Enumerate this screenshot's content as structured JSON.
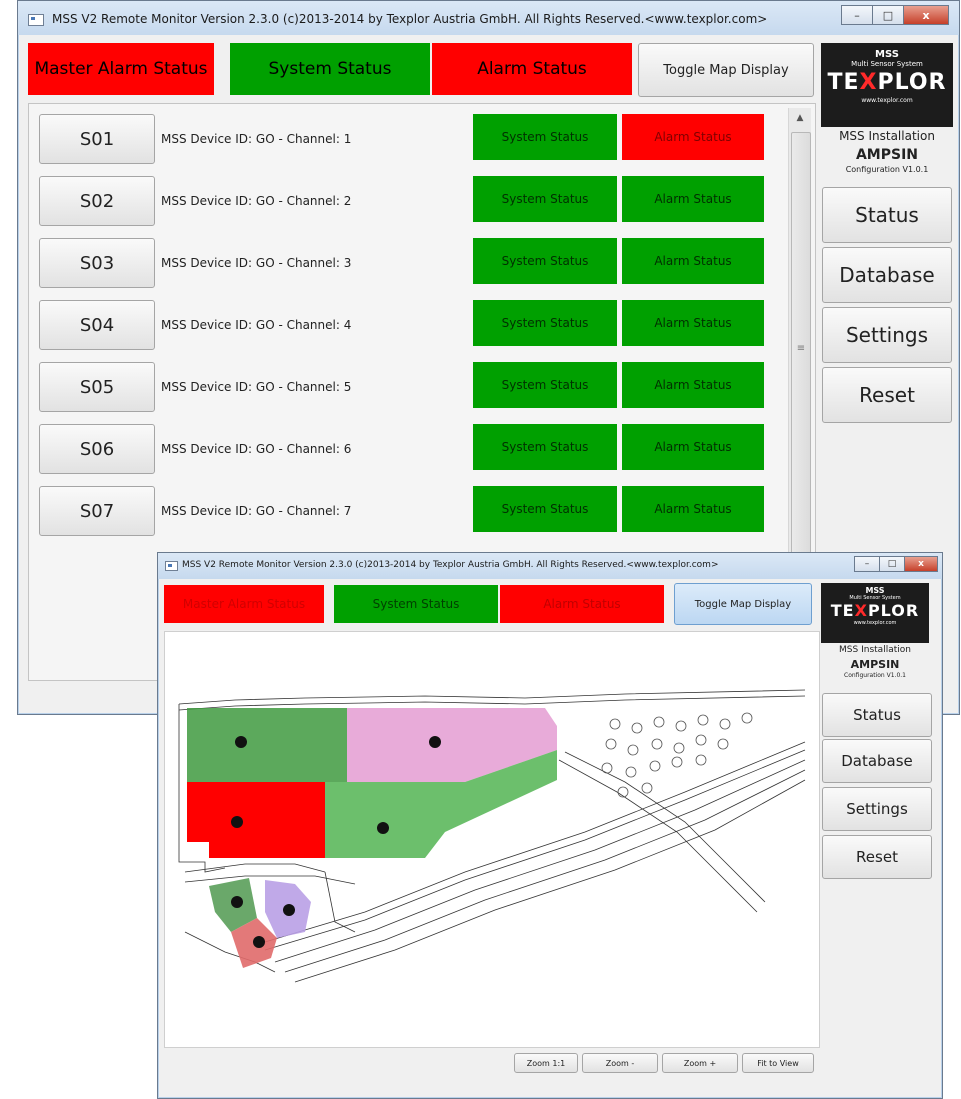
{
  "main_window": {
    "title": "MSS V2 Remote Monitor Version 2.3.0 (c)2013-2014 by Texplor Austria GmbH. All Rights Reserved.<www.texplor.com>",
    "minimize": "–",
    "maximize": "□",
    "close": "x",
    "header": {
      "master_alarm": "Master Alarm Status",
      "system_status": "System Status",
      "alarm_status": "Alarm Status",
      "toggle_map": "Toggle Map Display"
    },
    "devices": [
      {
        "id": "S01",
        "label": "MSS Device ID: GO - Channel: 1",
        "system": "System Status",
        "alarm": "Alarm Status",
        "alarm_state": "red"
      },
      {
        "id": "S02",
        "label": "MSS Device ID: GO - Channel: 2",
        "system": "System Status",
        "alarm": "Alarm Status",
        "alarm_state": "green"
      },
      {
        "id": "S03",
        "label": "MSS Device ID: GO - Channel: 3",
        "system": "System Status",
        "alarm": "Alarm Status",
        "alarm_state": "green"
      },
      {
        "id": "S04",
        "label": "MSS Device ID: GO - Channel: 4",
        "system": "System Status",
        "alarm": "Alarm Status",
        "alarm_state": "green"
      },
      {
        "id": "S05",
        "label": "MSS Device ID: GO - Channel: 5",
        "system": "System Status",
        "alarm": "Alarm Status",
        "alarm_state": "green"
      },
      {
        "id": "S06",
        "label": "MSS Device ID: GO - Channel: 6",
        "system": "System Status",
        "alarm": "Alarm Status",
        "alarm_state": "green"
      },
      {
        "id": "S07",
        "label": "MSS Device ID: GO - Channel: 7",
        "system": "System Status",
        "alarm": "Alarm Status",
        "alarm_state": "green"
      }
    ],
    "scroll_grip": "≡",
    "scroll_up": "▲"
  },
  "logo": {
    "mss": "MSS",
    "sub": "Multi Sensor System",
    "brand_a": "TE",
    "brand_x": "X",
    "brand_b": "PLOR",
    "url": "www.texplor.com"
  },
  "sidebar": {
    "installation_label": "MSS Installation",
    "installation_name": "AMPSIN",
    "configuration": "Configuration V1.0.1",
    "buttons": {
      "status": "Status",
      "database": "Database",
      "settings": "Settings",
      "reset": "Reset"
    }
  },
  "map_window": {
    "title": "MSS V2 Remote Monitor Version 2.3.0 (c)2013-2014 by Texplor Austria GmbH. All Rights Reserved.<www.texplor.com>",
    "header": {
      "master_alarm": "Master Alarm Status",
      "system_status": "System Status",
      "alarm_status": "Alarm Status",
      "toggle_map": "Toggle Map Display"
    },
    "zoom": {
      "zoom_1_1": "Zoom 1:1",
      "zoom_out": "Zoom -",
      "zoom_in": "Zoom +",
      "fit": "Fit to View"
    },
    "zone_colors": {
      "normal": "#5cb85c",
      "alarm": "#ff0000",
      "selected": "#e7a6d7",
      "secondary": "#b9a0e6",
      "warning": "#e06a6a"
    }
  }
}
